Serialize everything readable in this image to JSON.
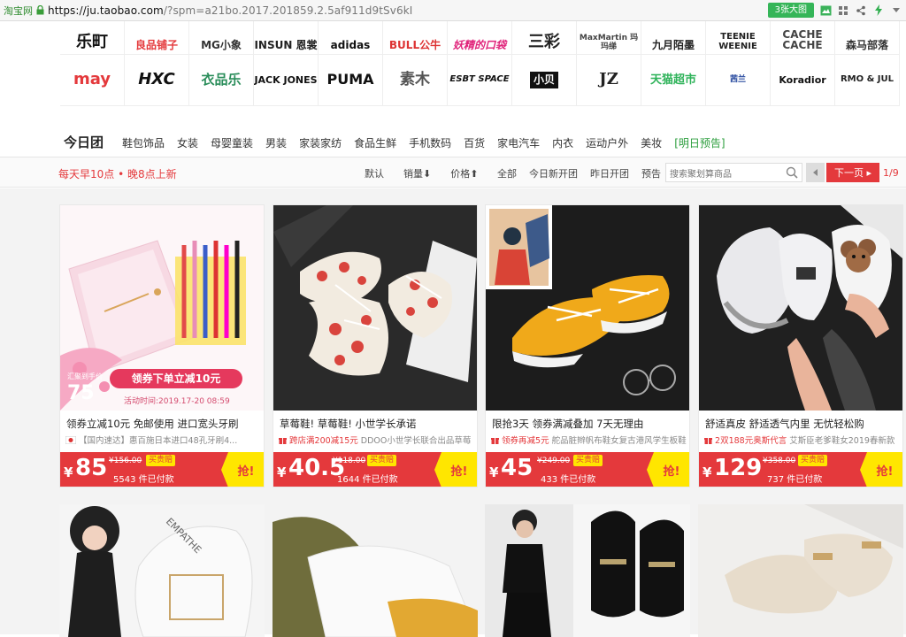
{
  "browser": {
    "site_badge": "淘宝网",
    "url_host": "https://ju.taobao.com",
    "url_rest": "/?spm=a21bo.2017.201859.2.5af911d9tSv6kI",
    "screen_button": "3张大图"
  },
  "brands": {
    "row1": [
      "乐町",
      "良品铺子",
      "MG小象",
      "INSUN 恩裳",
      "adidas",
      "BULL公牛",
      "妖精的口袋",
      "三彩",
      "MaxMartin 玛玛绨",
      "九月陌墨",
      "TEENIE WEENIE",
      "CACHE CACHE",
      "森马部落"
    ],
    "row2": [
      "may",
      "HXC",
      "衣品乐",
      "JACK JONES",
      "PUMA",
      "素木",
      "ESBT SPACE",
      "小贝",
      "JZ",
      "天猫超市",
      "茜兰",
      "Koradior",
      "RMO & JUL"
    ]
  },
  "catnav": {
    "today": "今日团",
    "items": [
      "鞋包饰品",
      "女装",
      "母婴童装",
      "男装",
      "家装家纺",
      "食品生鲜",
      "手机数码",
      "百货",
      "家电汽车",
      "内衣",
      "运动户外",
      "美妆",
      "[明日预告]"
    ]
  },
  "filter": {
    "slogan": "每天早10点 • 晚8点上新",
    "sorts": [
      "默认",
      "销量⬇",
      "价格⬆"
    ],
    "filters": [
      "全部",
      "今日新开团",
      "昨日开团",
      "预告"
    ],
    "search_placeholder": "搜索聚划算商品",
    "next_label": "下一页 ▸",
    "pager": "1/9"
  },
  "products": [
    {
      "title": "领券立减10元  免邮使用  进口宽头牙刷",
      "sub_prefix": "",
      "sub": "【国内速达】惠百施日本进口48孔牙刷4...",
      "price": "85",
      "orig": "¥156.00",
      "tag": "买贵赔",
      "sold": "5543 件已付款",
      "grab": "抢!",
      "coupon_line": "领券下单立减10元",
      "promo_price": "75",
      "promo_time": "活动时间:2019.17-20 08:59",
      "promo_badge": "汇聚到手价"
    },
    {
      "title": "草莓鞋!   草莓鞋!   小世学长承诺",
      "sub_prefix": "跨店满200减15元",
      "sub": " DDOO小世学长联合出品草莓",
      "price": "40.5",
      "orig": "¥118.00",
      "tag": "买贵赔",
      "sold": "1644 件已付款",
      "grab": "抢!"
    },
    {
      "title": "限抢3天   领券满减叠加  7天无理由",
      "sub_prefix": "领券再减5元",
      "sub": " 舵品脏辫帆布鞋女复古港风学生板鞋",
      "price": "45",
      "orig": "¥249.00",
      "tag": "买贵赔",
      "sold": "433 件已付款",
      "grab": "抢!"
    },
    {
      "title": "舒适真皮  舒适透气内里  无忧轻松购",
      "sub_prefix": "2双188元奥斯代言",
      "sub": " 艾斯臣老爹鞋女2019春新款",
      "price": "129",
      "orig": "¥358.00",
      "tag": "买贵赔",
      "sold": "737 件已付款",
      "grab": "抢!"
    }
  ],
  "colors": {
    "accent_red": "#e4393c",
    "accent_yellow": "#ffe600",
    "green": "#2a9d3b"
  }
}
